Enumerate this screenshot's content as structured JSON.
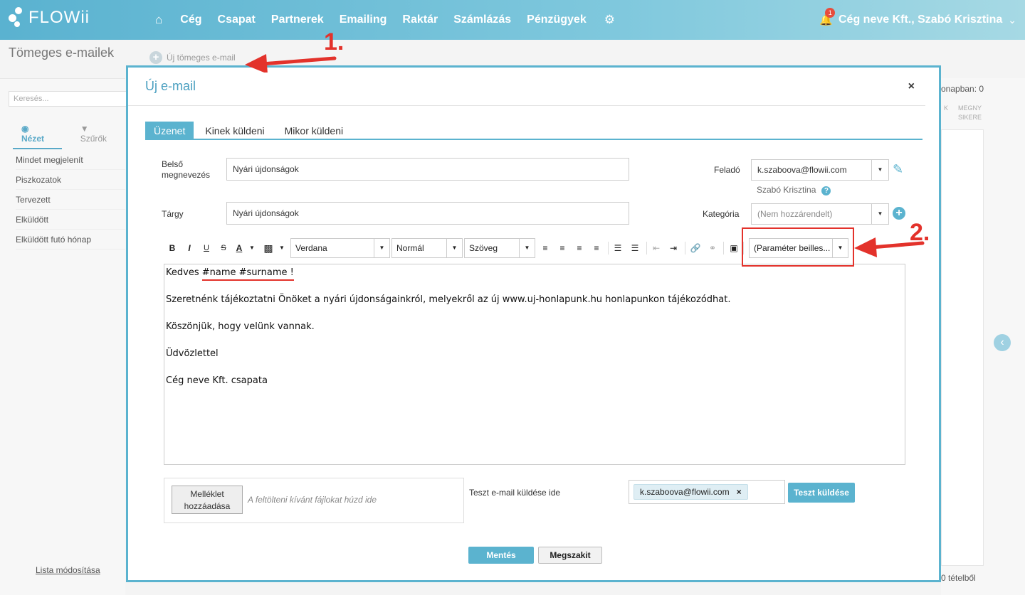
{
  "brand": {
    "name": "FLOWii"
  },
  "nav": {
    "items": [
      "Cég",
      "Csapat",
      "Partnerek",
      "Emailing",
      "Raktár",
      "Számlázás",
      "Pénzügyek"
    ],
    "notifications": "1",
    "user": "Cég neve Kft., Szabó Krisztina"
  },
  "background": {
    "page_title": "Tömeges e-mailek",
    "new_mass_email": "Új tömeges e-mail",
    "search_placeholder": "Keresés...",
    "tabs": [
      "Nézet",
      "Szűrők"
    ],
    "list": [
      "Mindet megjelenít",
      "Piszkozatok",
      "Tervezett",
      "Elküldött",
      "Elküldött futó hónap"
    ],
    "footer_link": "Lista módosítása",
    "right_text": "onapban: 0",
    "right_columns": [
      "K",
      "MEGNY",
      "SIKERE"
    ],
    "right_bottom": "0 tételből"
  },
  "modal": {
    "title": "Új e-mail",
    "close": "×",
    "tabs": [
      "Üzenet",
      "Kinek küldeni",
      "Mikor küldeni"
    ],
    "internal_name_label_1": "Belső",
    "internal_name_label_2": "megnevezés",
    "internal_name_value": "Nyári újdonságok",
    "subject_label": "Tárgy",
    "subject_value": "Nyári újdonságok",
    "sender_label": "Feladó",
    "sender_value": "k.szaboova@flowii.com",
    "sender_name": "Szabó Krisztina",
    "category_label": "Kategória",
    "category_value": "(Nem hozzárendelt)",
    "toolbar": {
      "bold": "B",
      "italic": "I",
      "underline": "U",
      "strike": "S",
      "font_color": "A",
      "font_family": "Verdana",
      "font_size": "Normál",
      "format": "Szöveg",
      "param_insert": "(Paraméter beilles..."
    },
    "editor": {
      "greeting_prefix": "Kedves ",
      "greeting_params": "#name #surname !",
      "line2": "Szeretnénk tájékoztatni Önöket a nyári újdonságainkról, melyekről az új www.uj-honlapunk.hu honlapunkon tájékozódhat.",
      "line3": "Köszönjük, hogy velünk vannak.",
      "line4": "Üdvözlettel",
      "line5": "Cég neve Kft. csapata"
    },
    "attach_button_1": "Melléklet",
    "attach_button_2": "hozzáadása",
    "attach_hint": "A feltölteni kívánt fájlokat húzd ide",
    "test_label": "Teszt e-mail küldése ide",
    "test_chip": "k.szaboova@flowii.com",
    "test_send": "Teszt küldése",
    "save": "Mentés",
    "cancel": "Megszakit"
  },
  "annotations": {
    "step1": "1.",
    "step2": "2."
  },
  "colors": {
    "accent": "#5bb3cf",
    "annotation": "#e3322b"
  }
}
